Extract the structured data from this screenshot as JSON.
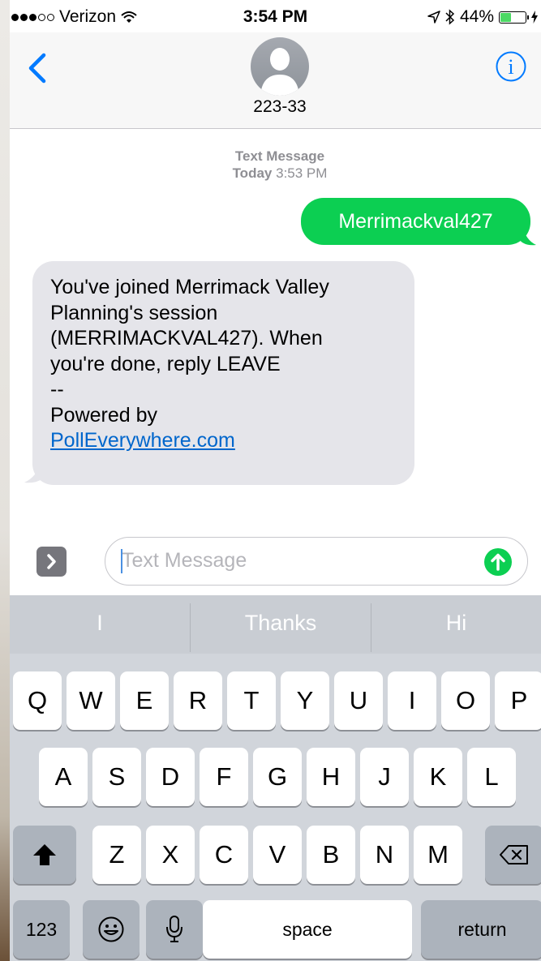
{
  "status_bar": {
    "carrier": "Verizon",
    "time": "3:54 PM",
    "battery_text": "44%",
    "battery_level": 0.44,
    "signal_bars_filled": 3,
    "signal_bars_total": 5,
    "icons": [
      "wifi-icon",
      "location-icon",
      "bluetooth-icon",
      "battery-icon",
      "charging-icon"
    ]
  },
  "header": {
    "contact_name": "223-33",
    "icons": [
      "back-chevron-icon",
      "person-avatar-icon",
      "info-icon"
    ]
  },
  "conversation": {
    "service": "Text Message",
    "day": "Today",
    "time": "3:53 PM",
    "sent": "Merrimackval427",
    "received_lines": [
      "You've joined Merrimack Valley",
      "Planning's session",
      "(MERRIMACKVAL427). When",
      "you're done, reply LEAVE",
      "--",
      "Powered by"
    ],
    "received_link": "PollEverywhere.com"
  },
  "input": {
    "placeholder": "Text Message",
    "value": "",
    "icons": [
      "apps-chevron-icon",
      "send-arrow-icon"
    ]
  },
  "keyboard": {
    "suggestions": [
      "I",
      "Thanks",
      "Hi"
    ],
    "row1": [
      "Q",
      "W",
      "E",
      "R",
      "T",
      "Y",
      "U",
      "I",
      "O",
      "P"
    ],
    "row2": [
      "A",
      "S",
      "D",
      "F",
      "G",
      "H",
      "J",
      "K",
      "L"
    ],
    "row3": [
      "Z",
      "X",
      "C",
      "V",
      "B",
      "N",
      "M"
    ],
    "numbers_label": "123",
    "space_label": "space",
    "return_label": "return",
    "icons": [
      "shift-icon",
      "backspace-icon",
      "emoji-icon",
      "microphone-icon"
    ]
  },
  "colors": {
    "sent_bubble": "#0ccf52",
    "received_bubble": "#e5e5ea",
    "ios_blue": "#007aff",
    "link": "#0066cc",
    "keyboard_bg": "#d1d5db"
  }
}
